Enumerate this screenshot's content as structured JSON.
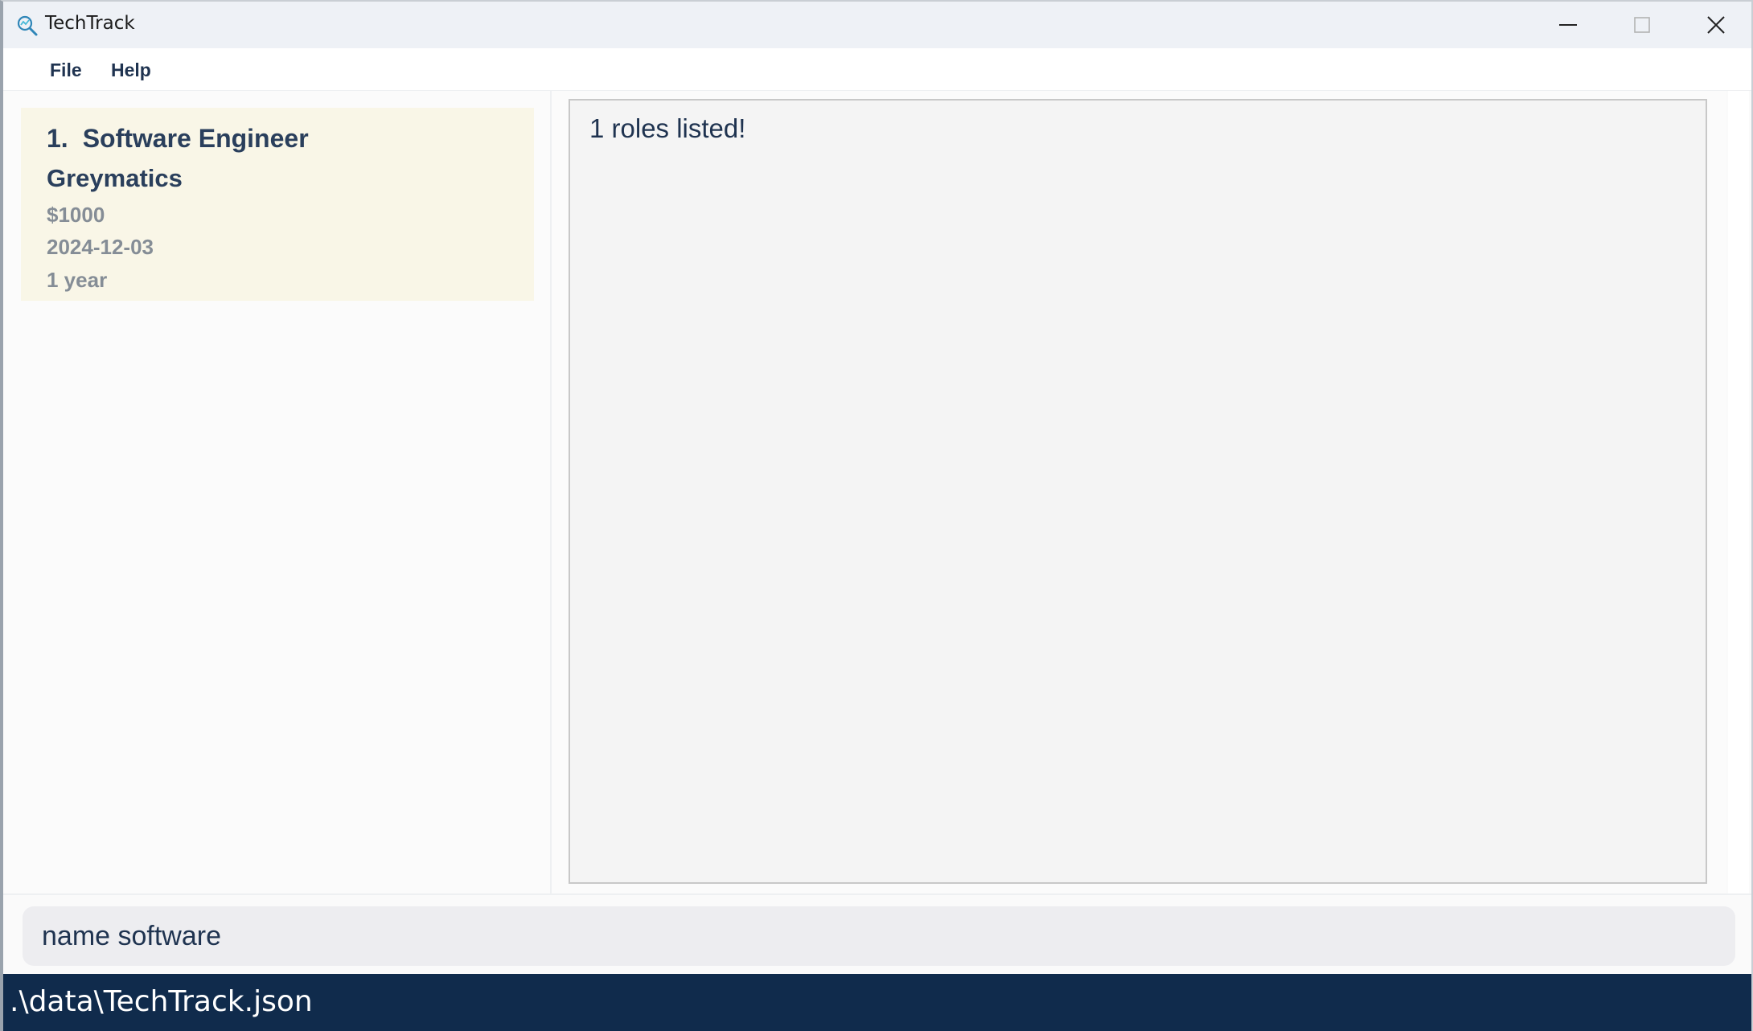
{
  "window": {
    "title": "TechTrack",
    "icon": "magnifier-icon",
    "controls": [
      "minimize-icon",
      "maximize-icon",
      "close-icon"
    ]
  },
  "menu": {
    "items": [
      "File",
      "Help"
    ]
  },
  "roles": [
    {
      "index": "1.",
      "name": "Software Engineer",
      "company": "Greymatics",
      "salary": "$1000",
      "deadline": "2024-12-03",
      "duration": "1 year"
    }
  ],
  "result": {
    "message": "1 roles listed!"
  },
  "command": {
    "value": "name software"
  },
  "status": {
    "file_path": ".\\data\\TechTrack.json"
  },
  "colors": {
    "card_background": "#f9f6e7",
    "primary_text": "#1f3350",
    "status_bar": "#102b4c"
  }
}
